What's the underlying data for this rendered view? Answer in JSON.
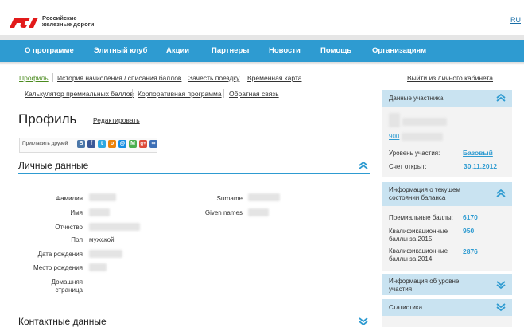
{
  "header": {
    "brand_line1": "Российские",
    "brand_line2": "железные дороги",
    "lang": "RU"
  },
  "nav": {
    "items": [
      "О программе",
      "Элитный клуб",
      "Акции",
      "Партнеры",
      "Новости",
      "Помощь",
      "Организациям"
    ]
  },
  "sublinks": {
    "row1": [
      "Профиль",
      "История начисления / списания баллов",
      "Зачесть поездку",
      "Временная карта"
    ],
    "row2": [
      "Калькулятор премиальных баллов",
      "Корпоративная программа",
      "Обратная связь"
    ],
    "logout": "Выйти из личного кабинета"
  },
  "profile": {
    "title": "Профиль",
    "edit": "Редактировать",
    "share_label": "Пригласить друзей"
  },
  "personal": {
    "title": "Личные данные",
    "labels": {
      "lastname": "Фамилия",
      "firstname": "Имя",
      "patronymic": "Отчество",
      "gender": "Пол",
      "birthdate": "Дата рождения",
      "birthplace": "Место рождения",
      "homepage_1": "Домашняя",
      "homepage_2": "страница",
      "surname": "Surname",
      "given_names": "Given names"
    },
    "gender_value": "мужской"
  },
  "contacts": {
    "title": "Контактные данные"
  },
  "participant": {
    "title": "Данные участника",
    "number": "900",
    "level_label": "Уровень участия:",
    "level_value": "Базовый",
    "opened_label": "Счет открыт:",
    "opened_value": "30.11.2012"
  },
  "balance": {
    "title_1": "Информация о текущем",
    "title_2": "состоянии баланса",
    "premium_label": "Премиальные баллы:",
    "premium_value": "6170",
    "q2015_1": "Квалификационные",
    "q2015_2": "баллы за 2015:",
    "q2015_value": "950",
    "q2014_1": "Квалификационные",
    "q2014_2": "баллы за 2014:",
    "q2014_value": "2876"
  },
  "level_info": {
    "title_1": "Информация об уровне",
    "title_2": "участия"
  },
  "stats": {
    "title": "Статистика"
  },
  "icons": {
    "logo": "rzd-logo-icon",
    "collapse": "chevron-up-icon",
    "expand": "chevron-down-icon"
  },
  "colors": {
    "nav": "#2e9bd1",
    "panel_head": "#c9e3f1",
    "brand_red": "#e21a1a",
    "active_link": "#4a8a1e"
  }
}
